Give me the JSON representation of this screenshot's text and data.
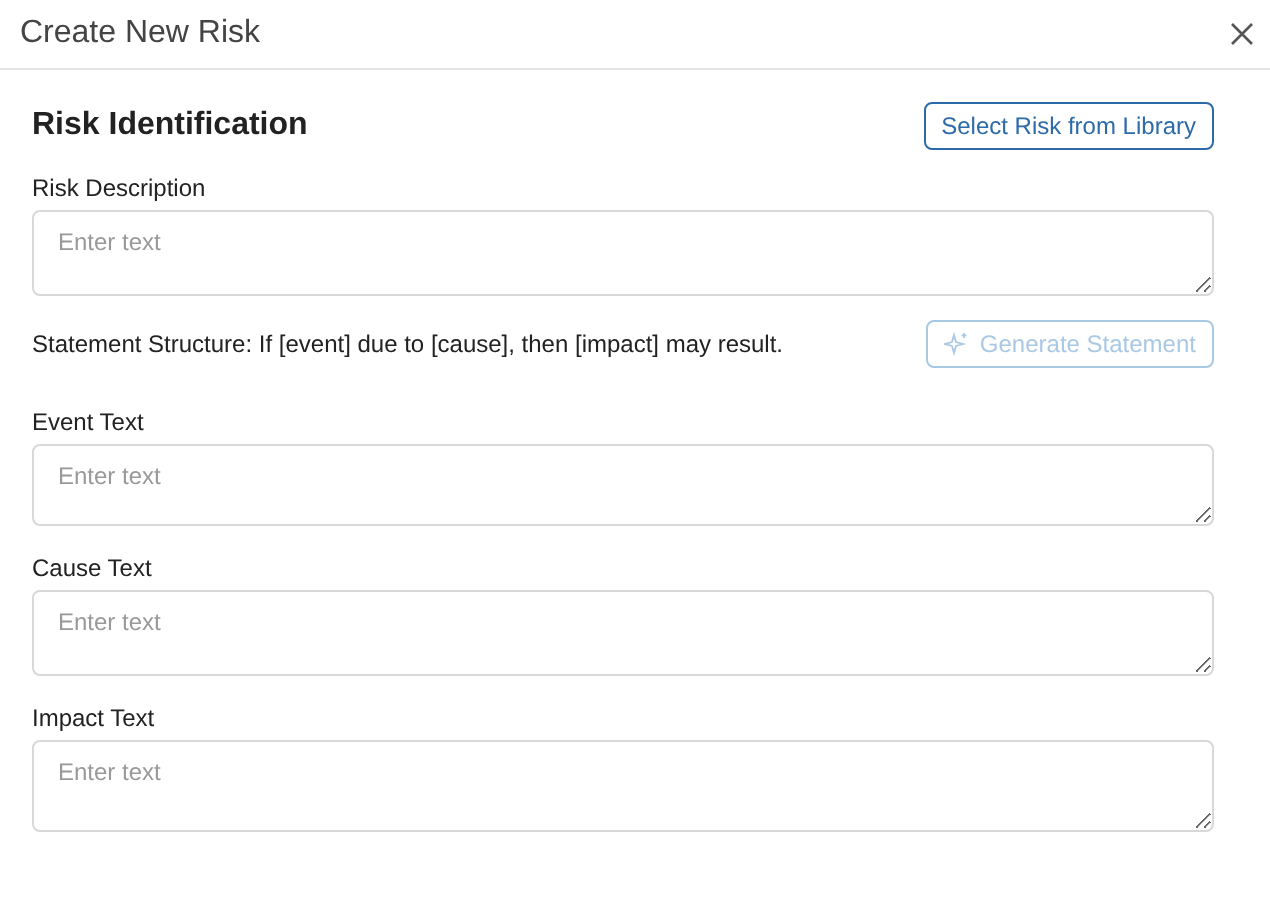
{
  "dialog": {
    "title": "Create New Risk"
  },
  "section": {
    "title": "Risk Identification",
    "library_button": {
      "label": "Select Risk from Library",
      "disabled": false
    }
  },
  "description_field": {
    "label": "Risk Description",
    "placeholder": "Enter text"
  },
  "statement": {
    "text": "Statement Structure: If [event] due to [cause], then [impact] may result.",
    "generate_button": {
      "label": "Generate Statement",
      "disabled": true
    }
  },
  "fields": [
    {
      "label": "Event Text",
      "placeholder": "Enter text"
    },
    {
      "label": "Cause Text",
      "placeholder": "Enter text"
    },
    {
      "label": "Impact Text",
      "placeholder": "Enter text"
    }
  ]
}
